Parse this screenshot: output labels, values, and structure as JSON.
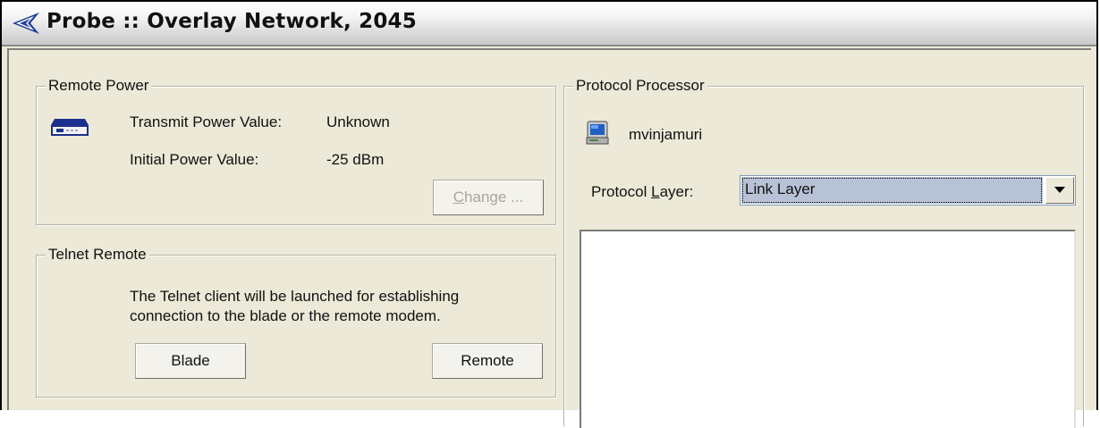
{
  "window": {
    "title": "Probe :: Overlay Network, 2045"
  },
  "remote_power": {
    "legend": "Remote Power",
    "transmit_label": "Transmit Power Value:",
    "transmit_value": "Unknown",
    "initial_label": "Initial Power Value:",
    "initial_value": "-25 dBm",
    "change_button": {
      "pre": "",
      "underlined": "C",
      "post": "hange ..."
    }
  },
  "telnet_remote": {
    "legend": "Telnet Remote",
    "description_line1": "The Telnet client will be launched for establishing",
    "description_line2": "connection to the blade or the remote modem.",
    "blade_button": "Blade",
    "remote_button": "Remote"
  },
  "protocol_processor": {
    "legend": "Protocol Processor",
    "host_name": "mvinjamuri",
    "layer_label": {
      "pre": "Protocol ",
      "underlined": "L",
      "post": "ayer:"
    },
    "layer_selected": "Link Layer"
  },
  "icons": {
    "title": "probe-icon",
    "device": "modem-device-icon",
    "host": "computer-icon",
    "dropdown": "chevron-down-icon"
  }
}
